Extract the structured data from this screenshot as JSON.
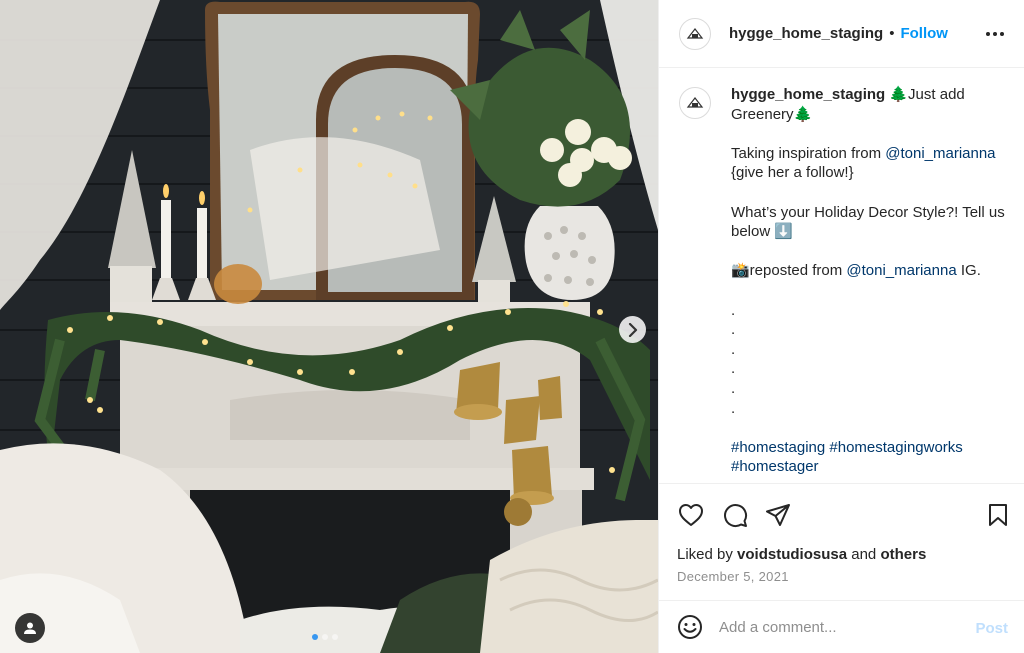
{
  "post": {
    "author": "hygge_home_staging",
    "follow_label": "Follow",
    "separator": "•",
    "avatar_text": "HYGGE"
  },
  "caption": {
    "author": "hygge_home_staging",
    "line1": " 🌲Just add Greenery🌲",
    "line2_prefix": "Taking inspiration from ",
    "mention": "@toni_marianna",
    "line2_suffix": " {give her a follow!}",
    "line3": "What’s your Holiday Decor Style?! Tell us below ⬇️",
    "line4_prefix": "📸reposted from ",
    "line4_mention": "@toni_marianna",
    "line4_suffix": " IG.",
    "dots": [
      ".",
      ".",
      ".",
      ".",
      ".",
      "."
    ],
    "hashtags": "#homestaging #homestagingworks #homestager"
  },
  "engagement": {
    "liked_by_prefix": "Liked by ",
    "liked_by_user": "voidstudiosusa",
    "liked_by_joiner": " and ",
    "liked_by_others": "others",
    "date": "December 5, 2021"
  },
  "comment": {
    "placeholder": "Add a comment...",
    "post_label": "Post"
  },
  "icons": {
    "more": "more-options-icon",
    "like": "heart-icon",
    "comment": "comment-icon",
    "share": "share-icon",
    "save": "bookmark-icon",
    "emoji": "emoji-icon",
    "next": "chevron-right-icon",
    "user_tags": "user-icon"
  },
  "colors": {
    "follow": "#0095f6",
    "mention": "#00376b",
    "muted": "#8e8e8e",
    "post_disabled": "#c0dffd",
    "carousel_active": "#3897f0"
  }
}
